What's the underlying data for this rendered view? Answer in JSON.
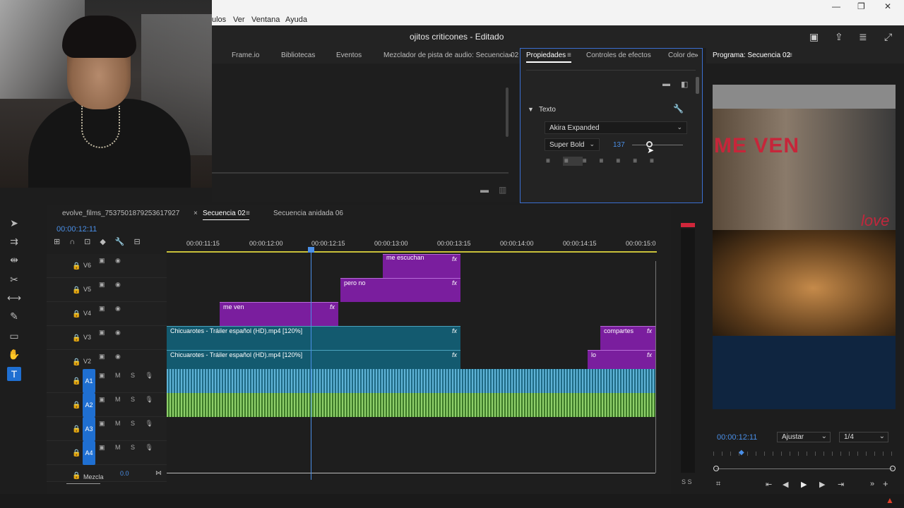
{
  "menu": {
    "items": [
      "ulos",
      "Ver",
      "Ventana",
      "Ayuda"
    ]
  },
  "window": {
    "title": "ojitos criticones - Editado",
    "minimize": "—",
    "maximize": "❐",
    "close": "✕"
  },
  "top_panel": {
    "tabs": [
      "Frame.io",
      "Bibliotecas",
      "Eventos",
      "Mezclador de pista de audio: Secuencia 02"
    ],
    "more": "»"
  },
  "properties": {
    "tabs": [
      "Propiedades",
      "Controles de efectos",
      "Color de"
    ],
    "section": "Texto",
    "font": "Akira Expanded",
    "style": "Super Bold",
    "size": "137"
  },
  "program": {
    "title": "Programa: Secuencia 02",
    "timecode": "00:00:12:11",
    "zoom": "Ajustar",
    "resolution": "1/4",
    "overlay_text": "ME VEN",
    "overlay_text2": "love"
  },
  "timeline": {
    "tabs": [
      "evolve_films_7537501879253617927",
      "Secuencia 02",
      "Secuencia anidada 06"
    ],
    "close_glyph": "×",
    "timecode": "00:00:12:11",
    "ruler": [
      "00:00:11:15",
      "00:00:12:00",
      "00:00:12:15",
      "00:00:13:00",
      "00:00:13:15",
      "00:00:14:00",
      "00:00:14:15",
      "00:00:15:0"
    ],
    "video_tracks": [
      "V6",
      "V5",
      "V4",
      "V3",
      "V2"
    ],
    "audio_tracks": [
      "A1",
      "A2",
      "A3",
      "A4"
    ],
    "mix_label": "Mezcla",
    "mix_value": "0.0",
    "clips": {
      "me_escuchan": "me escuchan",
      "pero_no": "pero no",
      "me_ven": "me ven",
      "chicuarotes_v3": "Chicuarotes - Tráiler español (HD).mp4 [120%]",
      "chicuarotes_v2": "Chicuarotes - Tráiler español (HD).mp4 [120%]",
      "compartes": "compartes",
      "lo": "lo",
      "fx": "fx"
    },
    "msb": "M   S",
    "vu_labels": "S  S"
  },
  "colors": {
    "accent": "#1f6fd1",
    "purple": "#7a1e9e",
    "teal": "#135a6f"
  }
}
